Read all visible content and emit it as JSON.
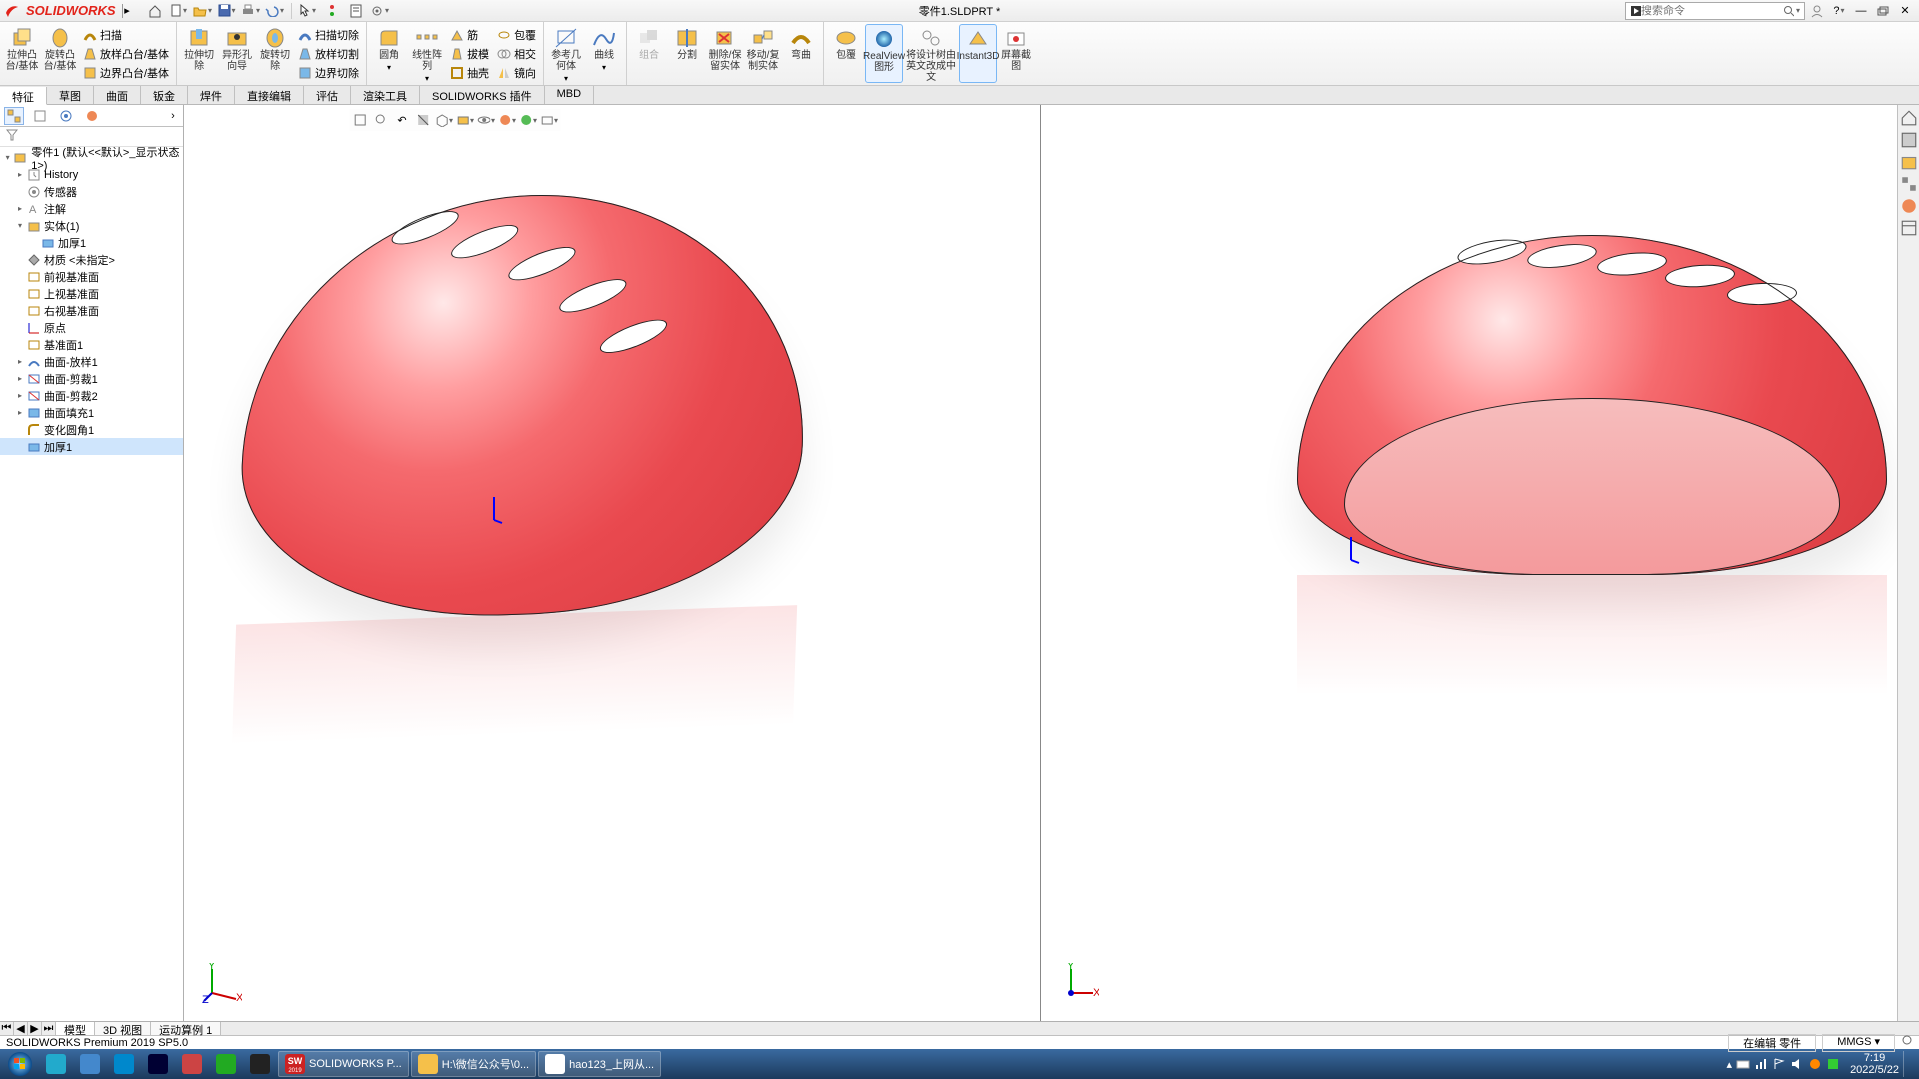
{
  "app_name": "SOLIDWORKS",
  "document_title": "零件1.SLDPRT *",
  "search_placeholder": "搜索命令",
  "ribbon": {
    "groups": [
      {
        "items": [
          {
            "label": "拉伸凸台/基体",
            "icon": "extrude-boss"
          },
          {
            "label": "旋转凸台/基体",
            "icon": "revolve-boss"
          }
        ],
        "side": [
          {
            "label": "扫描",
            "icon": "swept-boss"
          },
          {
            "label": "放样凸台/基体",
            "icon": "loft-boss"
          },
          {
            "label": "边界凸台/基体",
            "icon": "boundary-boss"
          }
        ]
      },
      {
        "items": [
          {
            "label": "拉伸切除",
            "icon": "extrude-cut"
          },
          {
            "label": "异形孔向导",
            "icon": "hole-wizard"
          },
          {
            "label": "旋转切除",
            "icon": "revolve-cut"
          }
        ],
        "side": [
          {
            "label": "扫描切除",
            "icon": "swept-cut"
          },
          {
            "label": "放样切割",
            "icon": "loft-cut"
          },
          {
            "label": "边界切除",
            "icon": "boundary-cut"
          }
        ]
      },
      {
        "items": [
          {
            "label": "圆角",
            "icon": "fillet"
          },
          {
            "label": "线性阵列",
            "icon": "linear-pattern"
          }
        ],
        "side": [
          {
            "label": "筋",
            "icon": "rib"
          },
          {
            "label": "拔模",
            "icon": "draft"
          },
          {
            "label": "抽壳",
            "icon": "shell"
          }
        ],
        "side2": [
          {
            "label": "包覆",
            "icon": "wrap"
          },
          {
            "label": "相交",
            "icon": "intersect"
          },
          {
            "label": "镜向",
            "icon": "mirror"
          }
        ]
      },
      {
        "items": [
          {
            "label": "参考几何体",
            "icon": "ref-geom"
          },
          {
            "label": "曲线",
            "icon": "curves"
          }
        ]
      },
      {
        "items": [
          {
            "label": "组合",
            "icon": "combine",
            "disabled": true
          },
          {
            "label": "分割",
            "icon": "split"
          },
          {
            "label": "删除/保留实体",
            "icon": "delete-keep"
          },
          {
            "label": "移动/复制实体",
            "icon": "move-copy"
          },
          {
            "label": "弯曲",
            "icon": "flex"
          }
        ]
      },
      {
        "items": [
          {
            "label": "包覆",
            "icon": "wrap2"
          },
          {
            "label": "RealView 图形",
            "icon": "realview",
            "active": true
          },
          {
            "label": "将设计树由英文改成中文",
            "icon": "tree-lang"
          },
          {
            "label": "Instant3D",
            "icon": "instant3d"
          },
          {
            "label": "屏幕截图",
            "icon": "screenshot"
          }
        ]
      }
    ]
  },
  "cm_tabs": [
    "特征",
    "草图",
    "曲面",
    "钣金",
    "焊件",
    "直接编辑",
    "评估",
    "渲染工具",
    "SOLIDWORKS 插件",
    "MBD"
  ],
  "cm_active": "特征",
  "tree": {
    "root": "零件1 (默认<<默认>_显示状态 1>)",
    "items": [
      {
        "label": "History",
        "icon": "history",
        "expandable": true
      },
      {
        "label": "传感器",
        "icon": "sensors"
      },
      {
        "label": "注解",
        "icon": "annotations",
        "expandable": true
      },
      {
        "label": "实体(1)",
        "icon": "solid-bodies",
        "expandable": true,
        "expanded": true,
        "children": [
          {
            "label": "加厚1",
            "icon": "thicken"
          }
        ]
      },
      {
        "label": "材质 <未指定>",
        "icon": "material"
      },
      {
        "label": "前视基准面",
        "icon": "plane"
      },
      {
        "label": "上视基准面",
        "icon": "plane"
      },
      {
        "label": "右视基准面",
        "icon": "plane"
      },
      {
        "label": "原点",
        "icon": "origin"
      },
      {
        "label": "基准面1",
        "icon": "plane"
      },
      {
        "label": "曲面-放样1",
        "icon": "surface-loft",
        "expandable": true
      },
      {
        "label": "曲面-剪裁1",
        "icon": "surface-trim",
        "expandable": true
      },
      {
        "label": "曲面-剪裁2",
        "icon": "surface-trim",
        "expandable": true
      },
      {
        "label": "曲面填充1",
        "icon": "surface-fill",
        "expandable": true
      },
      {
        "label": "变化圆角1",
        "icon": "var-fillet"
      },
      {
        "label": "加厚1",
        "icon": "thicken",
        "selected": true
      }
    ]
  },
  "bottom_tabs": [
    "模型",
    "3D 视图",
    "运动算例 1"
  ],
  "bottom_active": "模型",
  "status": {
    "left": "SOLIDWORKS Premium 2019 SP5.0",
    "right1": "在编辑 零件",
    "right2": "MMGS"
  },
  "taskbar": {
    "pinned": [
      "browser-360",
      "downloads",
      "edge",
      "photoshop",
      "recorder",
      "wechat",
      "tool-ok"
    ],
    "running": [
      {
        "label": "SOLIDWORKS P...",
        "icon": "sw"
      },
      {
        "label": "H:\\微信公众号\\0...",
        "icon": "folder"
      },
      {
        "label": "hao123_上网从...",
        "icon": "chrome"
      }
    ],
    "time": "7:19",
    "date": "2022/5/22"
  }
}
